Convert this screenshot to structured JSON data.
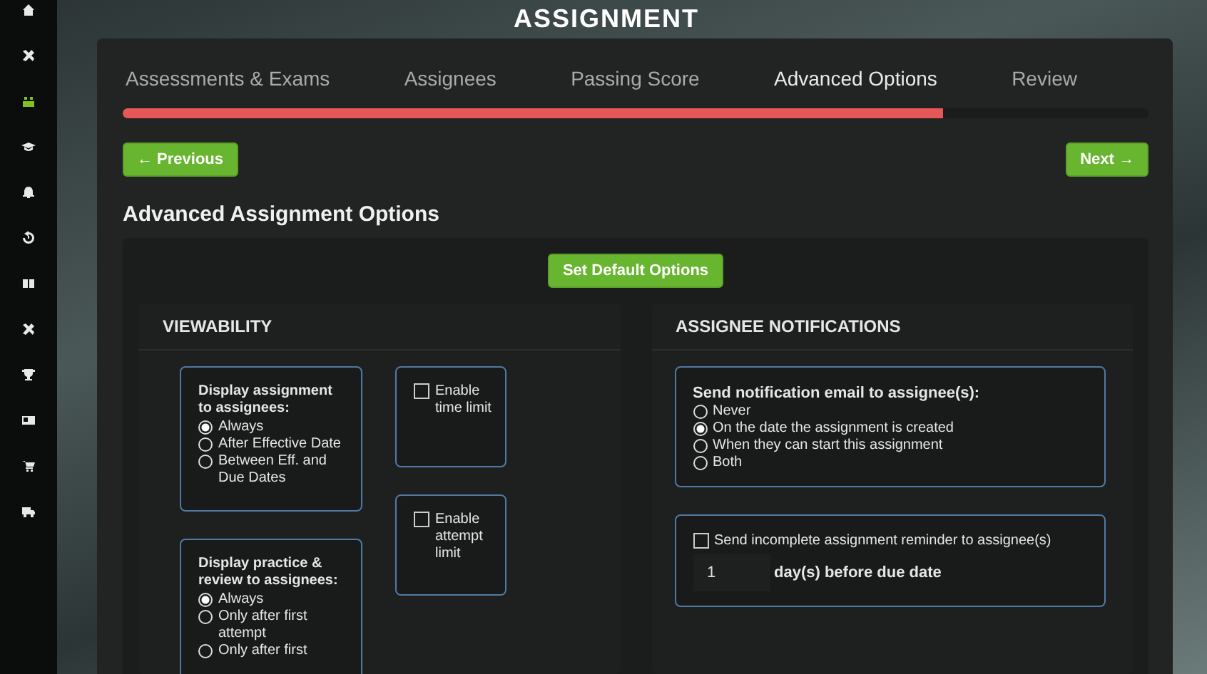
{
  "page_title": "ASSIGNMENT",
  "sidebar": {
    "items": [
      {
        "selected": false
      },
      {
        "selected": false
      },
      {
        "selected": true
      },
      {
        "selected": false
      },
      {
        "selected": false
      },
      {
        "selected": false
      },
      {
        "selected": false
      },
      {
        "selected": false
      },
      {
        "selected": false
      },
      {
        "selected": false
      },
      {
        "selected": false
      },
      {
        "selected": false
      }
    ]
  },
  "tabs": [
    {
      "label": "Assessments & Exams",
      "selected": false
    },
    {
      "label": "Assignees",
      "selected": false
    },
    {
      "label": "Passing Score",
      "selected": false
    },
    {
      "label": "Advanced Options",
      "selected": true
    },
    {
      "label": "Review",
      "selected": false
    }
  ],
  "progress": {
    "level": 0.8
  },
  "buttons": {
    "previous": "← Previous",
    "next": "Next →"
  },
  "heading": "Advanced Assignment Options",
  "default_button": "Set Default Options",
  "viewability": {
    "title": "VIEWABILITY",
    "display_assignment": {
      "label": "Display assignment to assignees:",
      "options": [
        {
          "label": "Always",
          "selected": true
        },
        {
          "label": "After Effective Date",
          "selected": false
        },
        {
          "label": "Between Eff. and Due Dates",
          "selected": false
        }
      ]
    },
    "display_practice": {
      "label": "Display practice & review to assignees:",
      "options": [
        {
          "label": "Always",
          "selected": true
        },
        {
          "label": "Only after first attempt",
          "selected": false
        },
        {
          "label": "Only after first",
          "selected": false
        }
      ]
    },
    "checkboxes": [
      {
        "label": "Enable time limit",
        "checked": false
      },
      {
        "label": "Enable attempt limit",
        "checked": false
      }
    ]
  },
  "notifications": {
    "title": "ASSIGNEE NOTIFICATIONS",
    "email": {
      "label": "Send notification email to assignee(s):",
      "options": [
        {
          "label": "Never",
          "selected": false
        },
        {
          "label": "On the date the assignment is created",
          "selected": true
        },
        {
          "label": "When they can start this assignment",
          "selected": false
        },
        {
          "label": "Both",
          "selected": false
        }
      ]
    },
    "reminder": {
      "label": "Send incomplete assignment reminder to assignee(s)",
      "checked": false,
      "days": "1",
      "suffix": "day(s) before due date"
    }
  }
}
